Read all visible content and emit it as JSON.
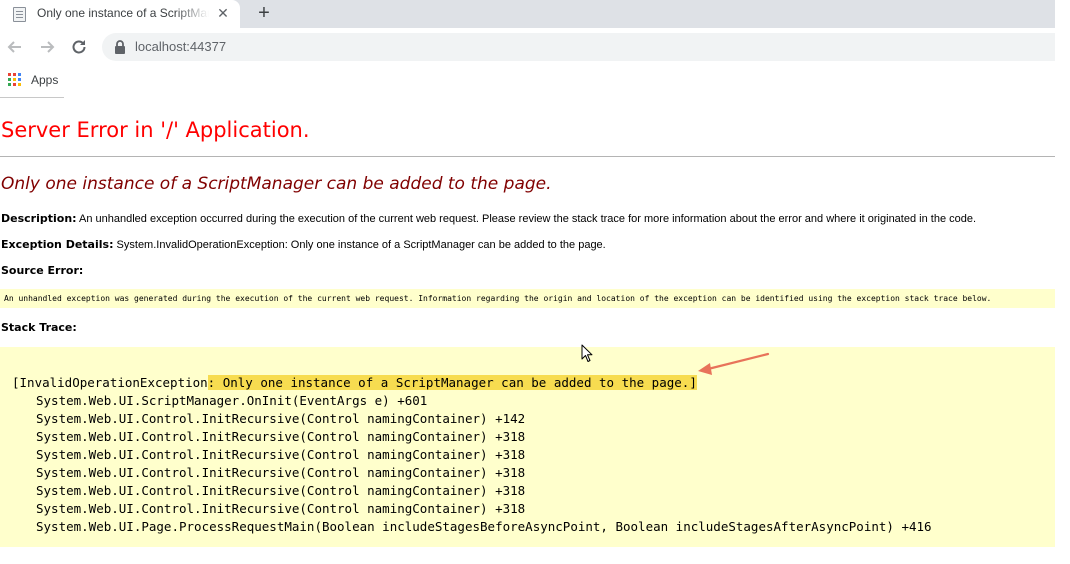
{
  "browser": {
    "tab": {
      "title": "Only one instance of a ScriptManager can be added to the page.",
      "close_glyph": "✕",
      "favicon": "page-icon"
    },
    "new_tab_glyph": "+",
    "nav": {
      "back_icon": "back-arrow-icon",
      "forward_icon": "forward-arrow-icon",
      "reload_icon": "reload-icon"
    },
    "address_bar": {
      "url": "localhost:44377",
      "icon": "lock-icon"
    },
    "bookmarks": {
      "apps_label": "Apps",
      "apps_icon": "apps-grid-icon"
    }
  },
  "error_page": {
    "title": "Server Error in '/' Application.",
    "exception_message": "Only one instance of a ScriptManager can be added to the page.",
    "description_label": "Description:",
    "description_text": "An unhandled exception occurred during the execution of the current web request. Please review the stack trace for more information about the error and where it originated in the code.",
    "exception_details_label": "Exception Details:",
    "exception_details_text": "System.InvalidOperationException: Only one instance of a ScriptManager can be added to the page.",
    "source_error_label": "Source Error:",
    "source_error_text": "An unhandled exception was generated during the execution of the current web request. Information regarding the origin and location of the exception can be identified using the exception stack trace below.",
    "stack_trace_label": "Stack Trace:",
    "stack_first_prefix": "[InvalidOperationException",
    "stack_first_highlight": ": Only one instance of a ScriptManager can be added to the page.]",
    "stack_lines": [
      "System.Web.UI.ScriptManager.OnInit(EventArgs e) +601",
      "System.Web.UI.Control.InitRecursive(Control namingContainer) +142",
      "System.Web.UI.Control.InitRecursive(Control namingContainer) +318",
      "System.Web.UI.Control.InitRecursive(Control namingContainer) +318",
      "System.Web.UI.Control.InitRecursive(Control namingContainer) +318",
      "System.Web.UI.Control.InitRecursive(Control namingContainer) +318",
      "System.Web.UI.Control.InitRecursive(Control namingContainer) +318",
      "System.Web.UI.Page.ProcessRequestMain(Boolean includeStagesBeforeAsyncPoint, Boolean includeStagesAfterAsyncPoint) +416"
    ]
  },
  "colors": {
    "title_red": "#ff0000",
    "heading_maroon": "#800000",
    "code_background": "#ffffcc",
    "highlight_yellow": "#f7dc50",
    "annotation_arrow": "#e8735a"
  },
  "overlays": {
    "annotation": "arrow-icon",
    "cursor": "mouse-cursor-icon"
  }
}
